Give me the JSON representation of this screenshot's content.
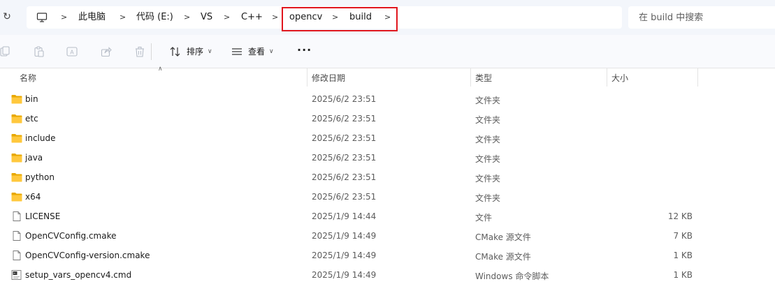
{
  "address_bar": {
    "crumbs": [
      "此电脑",
      "代码 (E:)",
      "VS",
      "C++",
      "opencv",
      "build"
    ],
    "search_placeholder": "在 build 中搜索",
    "highlight_color": "#e0161e"
  },
  "toolbar": {
    "icons": [
      "copy-icon",
      "paste-icon",
      "rename-icon",
      "share-icon",
      "delete-icon"
    ],
    "sort_label": "排序",
    "view_label": "查看",
    "more_label": "···"
  },
  "columns": {
    "name": "名称",
    "date": "修改日期",
    "type": "类型",
    "size": "大小"
  },
  "files": [
    {
      "icon": "folder-icon",
      "name": "bin",
      "date": "2025/6/2 23:51",
      "type": "文件夹",
      "size": ""
    },
    {
      "icon": "folder-icon",
      "name": "etc",
      "date": "2025/6/2 23:51",
      "type": "文件夹",
      "size": ""
    },
    {
      "icon": "folder-icon",
      "name": "include",
      "date": "2025/6/2 23:51",
      "type": "文件夹",
      "size": ""
    },
    {
      "icon": "folder-icon",
      "name": "java",
      "date": "2025/6/2 23:51",
      "type": "文件夹",
      "size": ""
    },
    {
      "icon": "folder-icon",
      "name": "python",
      "date": "2025/6/2 23:51",
      "type": "文件夹",
      "size": ""
    },
    {
      "icon": "folder-icon",
      "name": "x64",
      "date": "2025/6/2 23:51",
      "type": "文件夹",
      "size": ""
    },
    {
      "icon": "file-icon",
      "name": "LICENSE",
      "date": "2025/1/9 14:44",
      "type": "文件",
      "size": "12 KB"
    },
    {
      "icon": "file-icon",
      "name": "OpenCVConfig.cmake",
      "date": "2025/1/9 14:49",
      "type": "CMake 源文件",
      "size": "7 KB"
    },
    {
      "icon": "file-icon",
      "name": "OpenCVConfig-version.cmake",
      "date": "2025/1/9 14:49",
      "type": "CMake 源文件",
      "size": "1 KB"
    },
    {
      "icon": "cmd-file-icon",
      "name": "setup_vars_opencv4.cmd",
      "date": "2025/1/9 14:49",
      "type": "Windows 命令脚本",
      "size": "1 KB"
    }
  ]
}
